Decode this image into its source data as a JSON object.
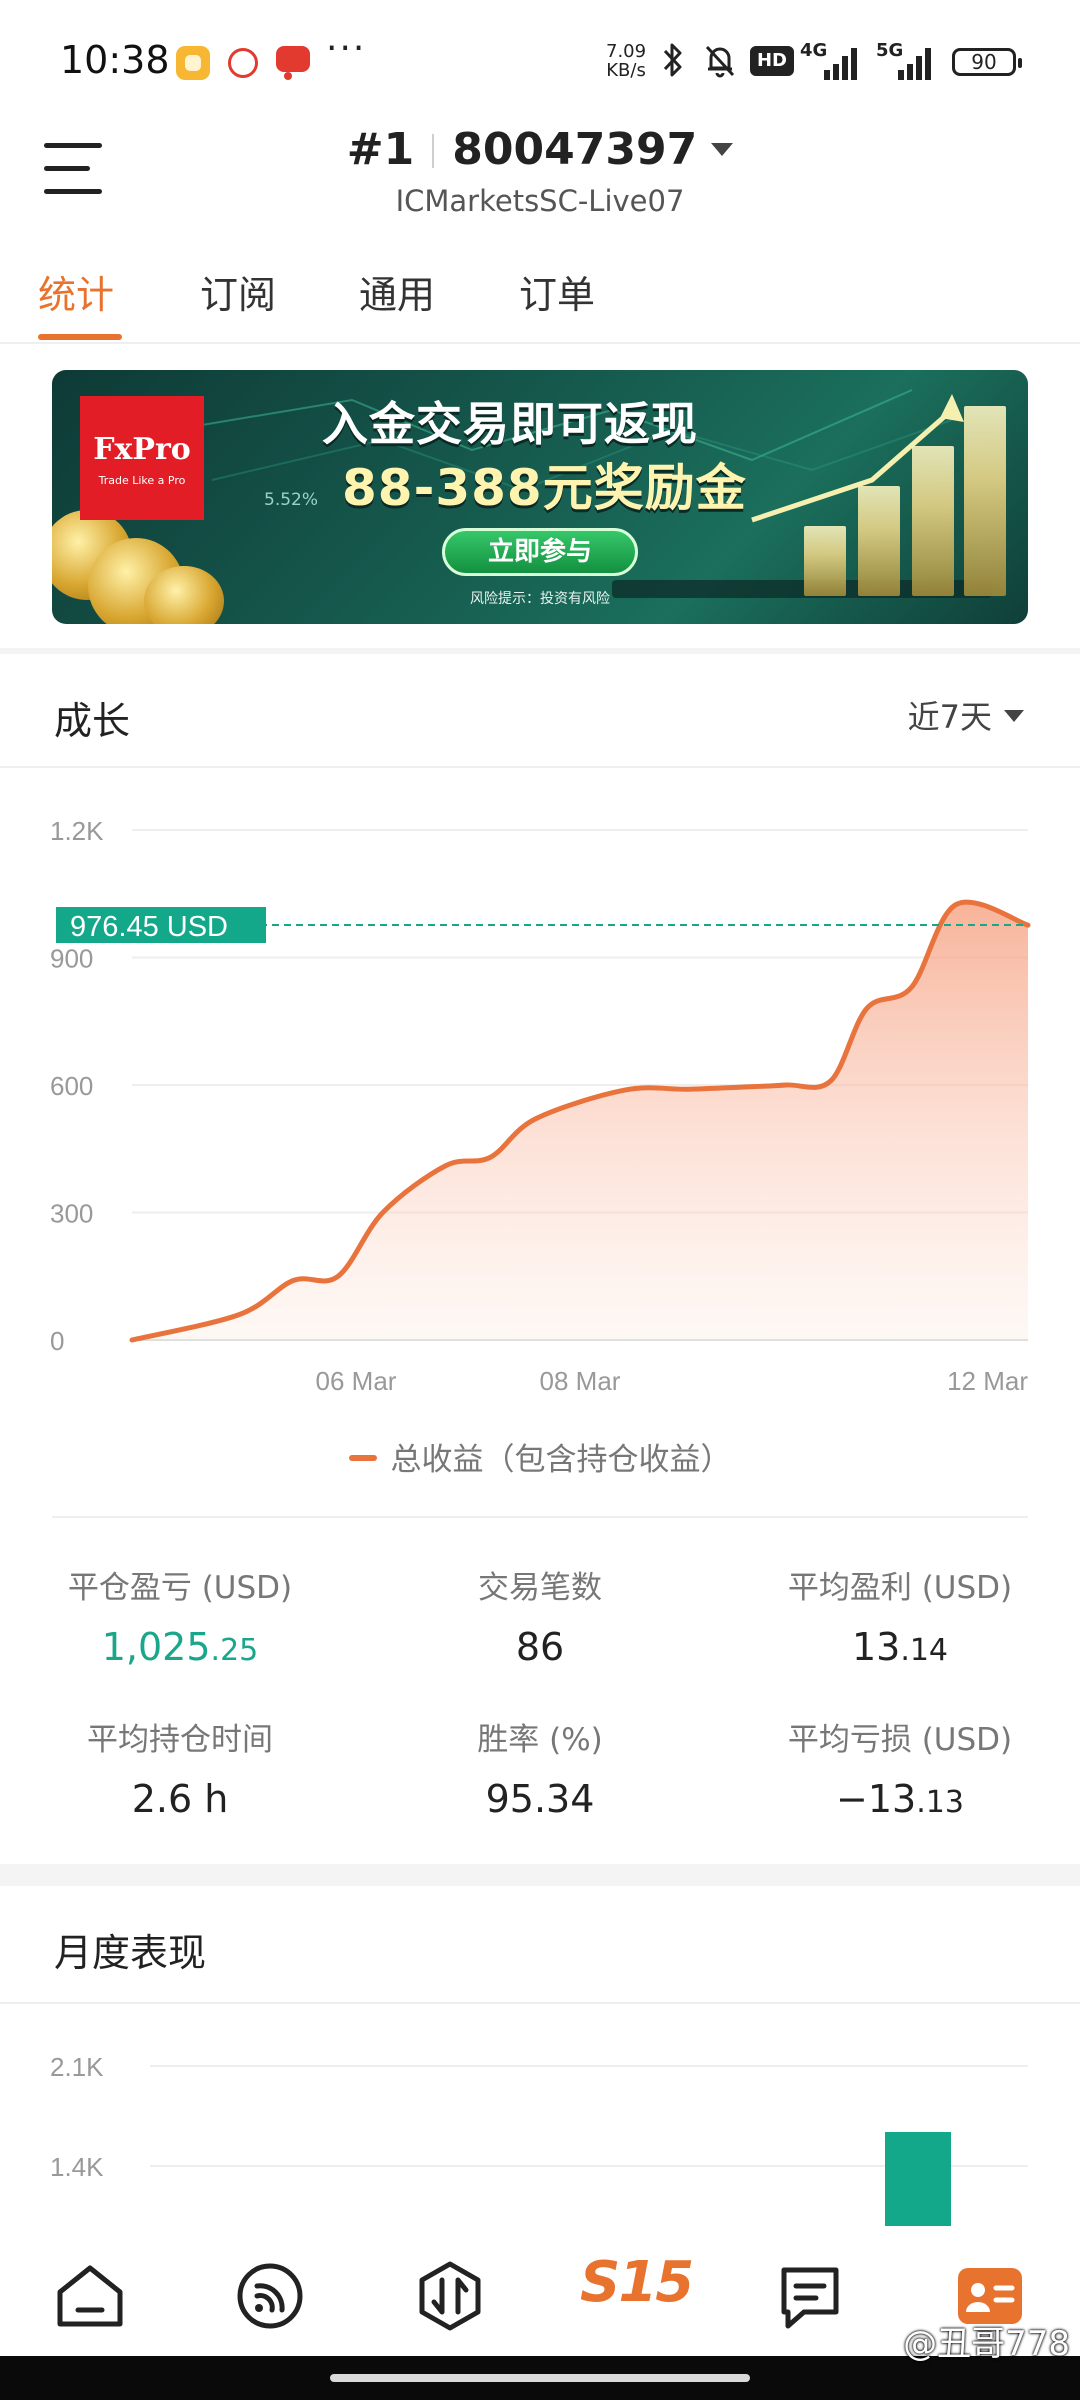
{
  "status_bar": {
    "time": "10:38",
    "net_speed_value": "7.09",
    "net_speed_unit": "KB/s",
    "hd_label": "HD",
    "net_1": "4G",
    "net_2": "5G",
    "battery": "90",
    "more": "···"
  },
  "header": {
    "rank": "#1",
    "account_number": "80047397",
    "server": "ICMarketsSC-Live07"
  },
  "tabs": [
    {
      "label": "统计",
      "active": true
    },
    {
      "label": "订阅",
      "active": false
    },
    {
      "label": "通用",
      "active": false
    },
    {
      "label": "订单",
      "active": false
    }
  ],
  "banner": {
    "brand": "FxPro",
    "brand_tagline": "Trade Like a Pro",
    "headline": "入金交易即可返现",
    "subheadline": "88-388元奖励金",
    "cta": "立即参与",
    "risk_note": "风险提示：投资有风险",
    "percent_tag": "5.52%"
  },
  "growth": {
    "title": "成长",
    "range_label": "近7天",
    "current_value_label": "976.45 USD",
    "legend": "总收益（包含持仓收益）"
  },
  "chart_data": {
    "type": "area",
    "title": "成长",
    "y_ticks": [
      "1.2K",
      "900",
      "600",
      "300",
      "0"
    ],
    "x_ticks": [
      "06 Mar",
      "08 Mar",
      "12 Mar"
    ],
    "ylim": [
      0,
      1200
    ],
    "series": [
      {
        "name": "总收益（包含持仓收益）",
        "color": "#e8733c",
        "x": [
          0,
          0.12,
          0.18,
          0.23,
          0.28,
          0.35,
          0.4,
          0.45,
          0.55,
          0.62,
          0.68,
          0.73,
          0.78,
          0.82,
          0.87,
          0.92,
          1.0
        ],
        "values": [
          0,
          60,
          140,
          150,
          300,
          410,
          430,
          520,
          588,
          590,
          595,
          600,
          610,
          780,
          830,
          1025,
          976
        ]
      }
    ],
    "reference_line": {
      "value": 976.45,
      "label": "976.45 USD",
      "color": "#1aa68a"
    },
    "grid": true,
    "legend_position": "bottom"
  },
  "stats": [
    {
      "label": "平仓盈亏 (USD)",
      "value_int": "1,025",
      "value_dec": ".25",
      "color": "green"
    },
    {
      "label": "交易笔数",
      "value_int": "86",
      "value_dec": "",
      "color": "default"
    },
    {
      "label": "平均盈利 (USD)",
      "value_int": "13",
      "value_dec": ".14",
      "color": "default"
    },
    {
      "label": "平均持仓时间",
      "value_int": "2.6 h",
      "value_dec": "",
      "color": "default"
    },
    {
      "label": "胜率 (%)",
      "value_int": "95.34",
      "value_dec": "",
      "color": "default"
    },
    {
      "label": "平均亏损 (USD)",
      "value_int": "−13",
      "value_dec": ".13",
      "color": "default"
    }
  ],
  "monthly": {
    "title": "月度表现"
  },
  "monthly_chart": {
    "type": "bar",
    "y_ticks": [
      "2.1K",
      "1.4K"
    ],
    "bar_color": "#14a88a"
  },
  "bottom_nav": {
    "center_logo": "S15",
    "items": [
      "home-icon",
      "feed-icon",
      "trade-icon",
      "s15-logo",
      "messages-icon",
      "profile-icon"
    ]
  },
  "watermark": "@丑哥778"
}
